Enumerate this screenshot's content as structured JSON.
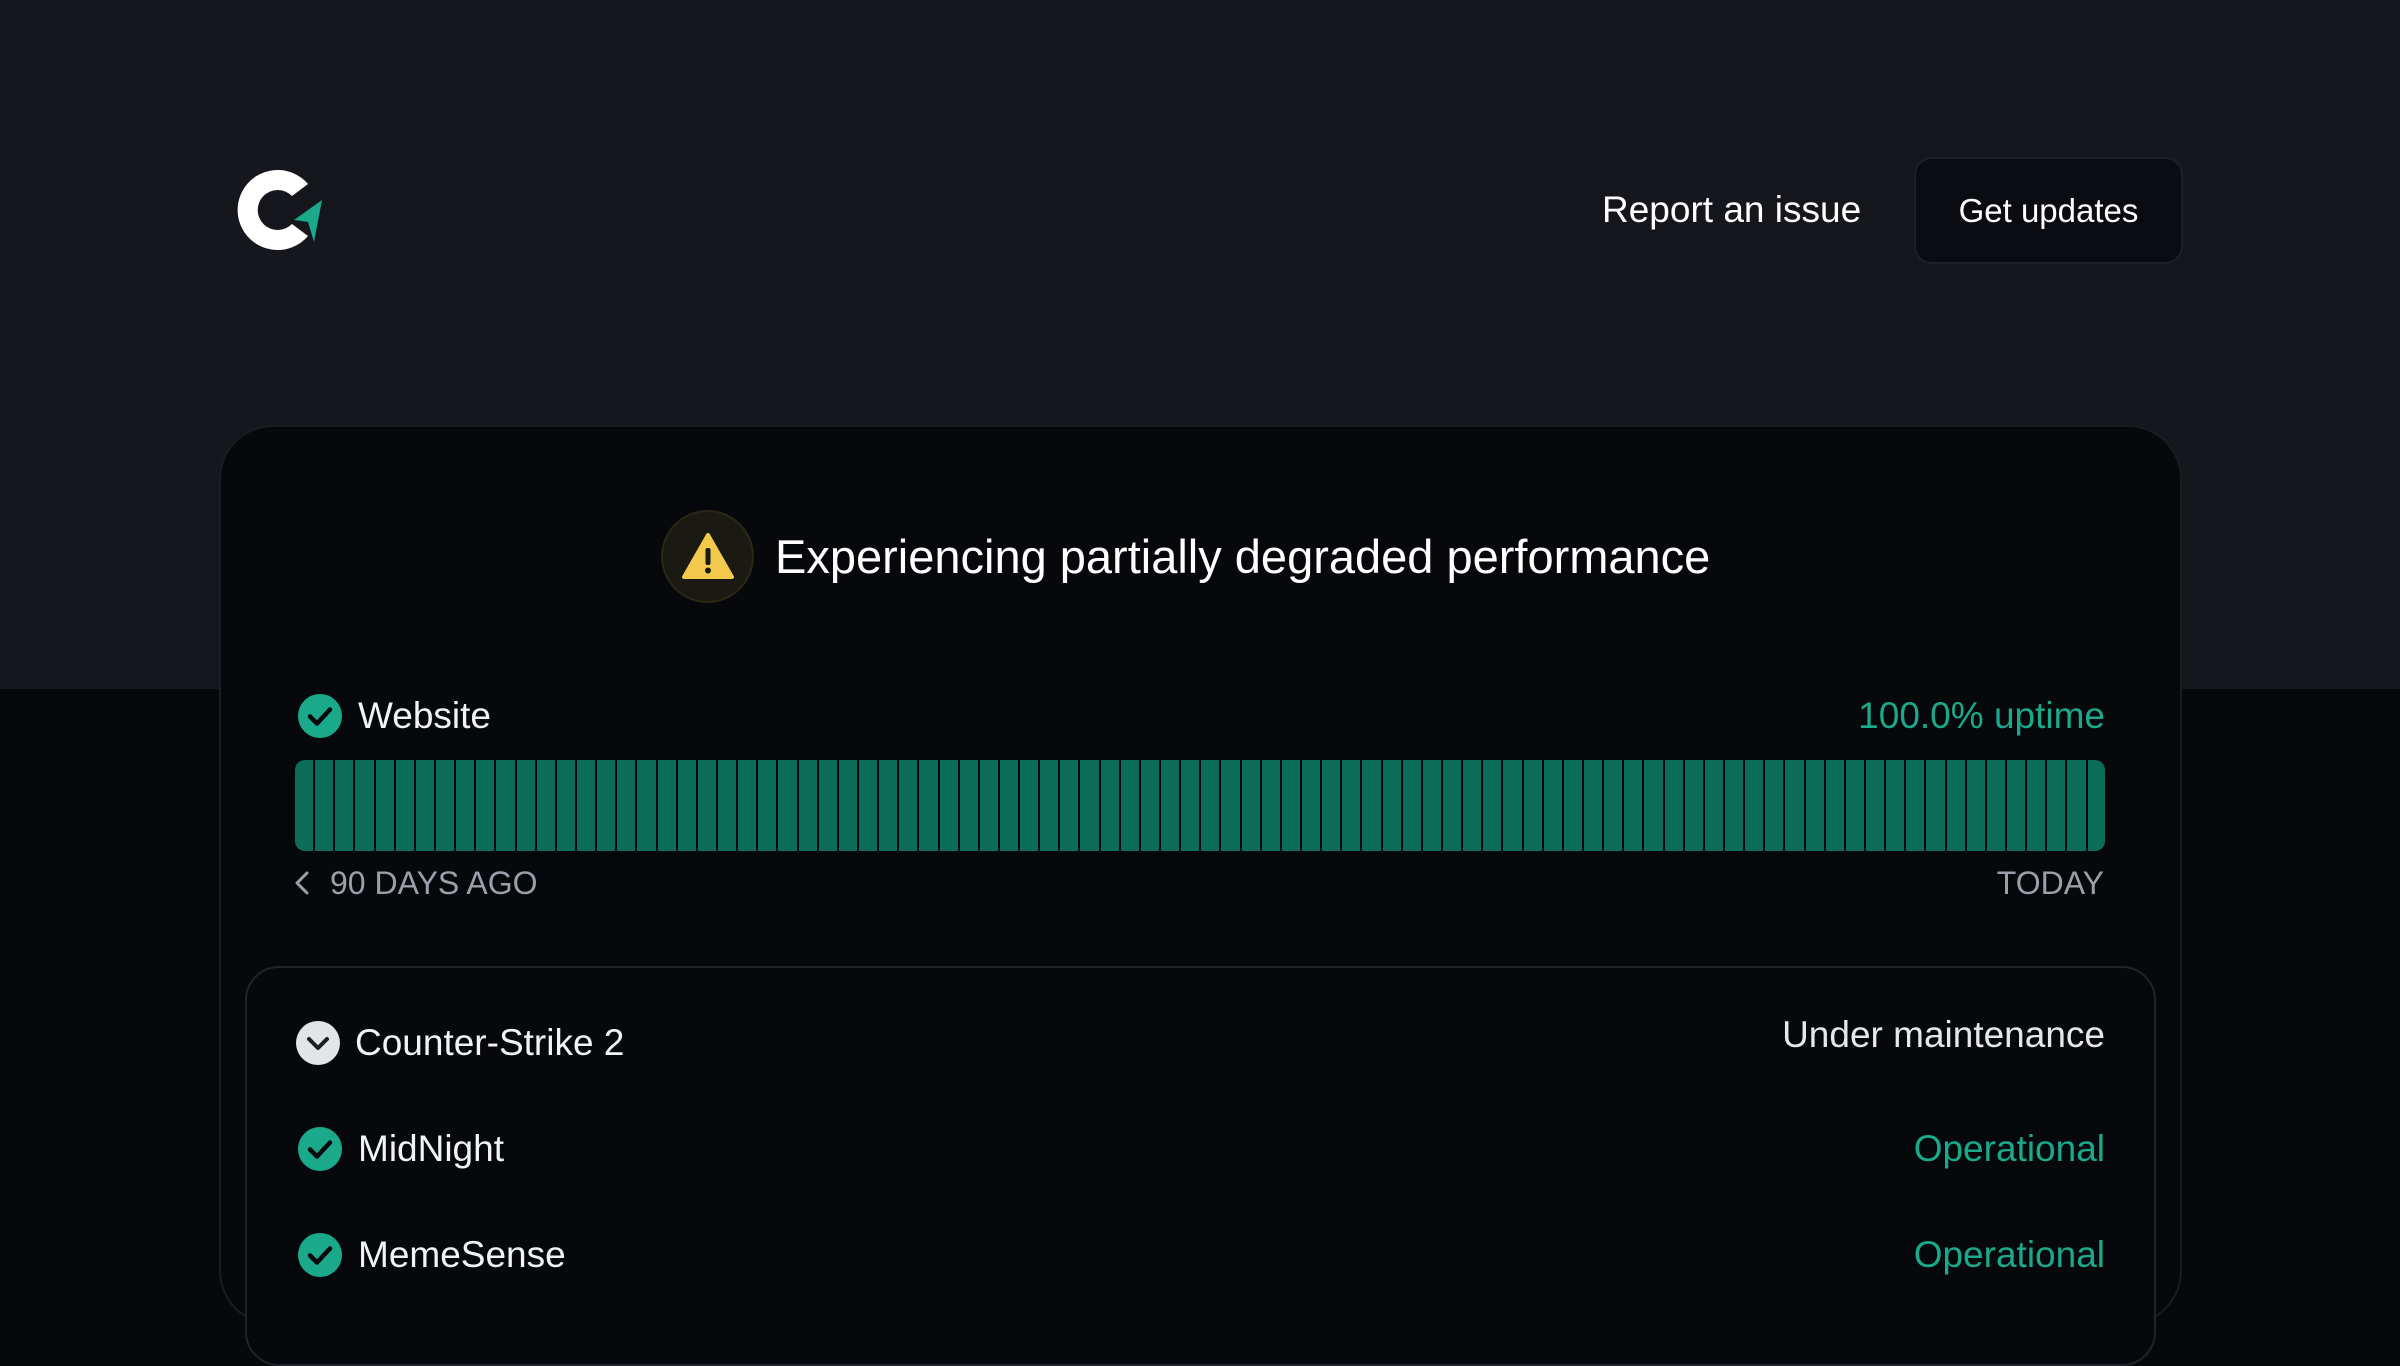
{
  "header": {
    "report_label": "Report an issue",
    "updates_label": "Get updates"
  },
  "banner": {
    "icon": "warning-icon",
    "text": "Experiencing partially degraded performance"
  },
  "website": {
    "name": "Website",
    "uptime": "100.0% uptime",
    "bar_count": 90,
    "range_start": "90 DAYS AGO",
    "range_end": "TODAY"
  },
  "components": [
    {
      "name": "Counter-Strike 2",
      "status": "Under maintenance",
      "icon": "chevron-down-icon"
    },
    {
      "name": "MidNight",
      "status": "Operational",
      "icon": "check-circle-icon"
    },
    {
      "name": "MemeSense",
      "status": "Operational",
      "icon": "check-circle-icon"
    }
  ],
  "colors": {
    "accent": "#1aa98a",
    "bar": "#0c6e59",
    "warning": "#f2c94c",
    "header_bg": "#15171c",
    "page_bg": "#07080b"
  }
}
